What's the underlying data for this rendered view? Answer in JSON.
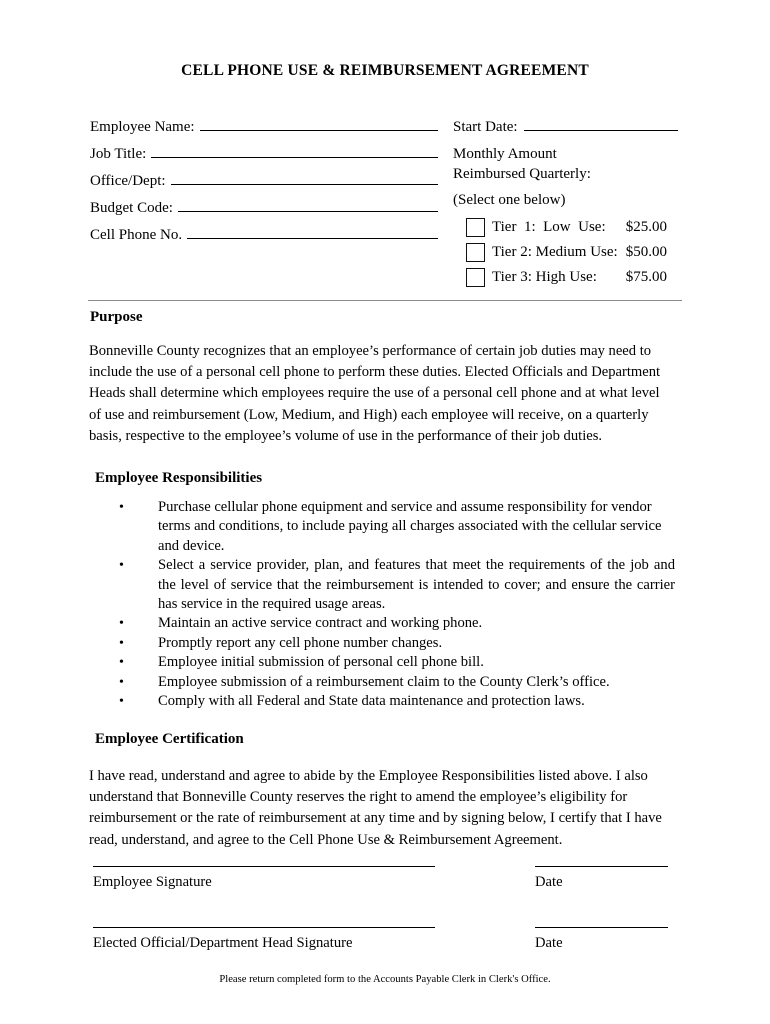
{
  "document": {
    "title": "CELL PHONE USE & REIMBURSEMENT AGREEMENT"
  },
  "form": {
    "left_fields": [
      {
        "label": "Employee Name:"
      },
      {
        "label": "Job Title:"
      },
      {
        "label": "Office/Dept:"
      },
      {
        "label": "Budget Code:"
      },
      {
        "label": "Cell Phone No."
      }
    ],
    "right": {
      "start_date_label": "Start Date:",
      "monthly_line_1": "Monthly Amount",
      "monthly_line_2": "Reimbursed Quarterly:",
      "select_one": "(Select one below)",
      "tiers": [
        {
          "name": "Tier  1:  Low  Use:",
          "amount": "$25.00"
        },
        {
          "name": "Tier 2: Medium Use:",
          "amount": "$50.00"
        },
        {
          "name": "Tier 3: High Use:",
          "amount": "$75.00"
        }
      ]
    }
  },
  "purpose": {
    "heading": "Purpose",
    "body": "Bonneville County recognizes that an employee’s performance of certain job duties may need to include the use of a personal cell phone to perform these duties.  Elected Officials and Department Heads shall determine which employees require the use of a personal cell phone and at what level of use and reimbursement (Low, Medium, and High) each employee will receive, on a quarterly basis, respective to the employee’s volume of use in the performance of their job duties."
  },
  "responsibilities": {
    "heading": "Employee Responsibilities",
    "bullet_char": "•",
    "items": [
      "Purchase cellular phone equipment and service and assume responsibility for vendor terms and conditions, to include paying all charges associated with the cellular service and device.",
      "Select a service provider, plan, and features that meet the requirements of the job and the level of service that the reimbursement is intended to cover; and ensure the carrier has service in the required usage areas.",
      "Maintain an active service contract and working phone.",
      "Promptly report any cell phone number changes.",
      "Employee initial submission of personal cell phone bill.",
      "Employee submission of a reimbursement claim to the County Clerk’s office.",
      "Comply with all Federal and State data maintenance and protection laws."
    ]
  },
  "certification": {
    "heading": "Employee Certification",
    "body": "I have read, understand and agree to abide by the Employee Responsibilities listed above.  I also understand that Bonneville County reserves the right to amend the employee’s eligibility for reimbursement or the rate of reimbursement at any time and by signing below, I certify that I have read, understand, and agree to the Cell Phone Use & Reimbursement Agreement."
  },
  "signatures": {
    "employee_signature_label": "Employee Signature",
    "employee_date_label": "Date",
    "official_signature_label": "Elected Official/Department Head Signature",
    "official_date_label": "Date"
  },
  "footer": {
    "note": "Please return completed form to the Accounts Payable Clerk in Clerk's Office."
  },
  "colors": {
    "text": "#000000",
    "divider": "#8c8c8c",
    "page_background": "#ffffff"
  }
}
